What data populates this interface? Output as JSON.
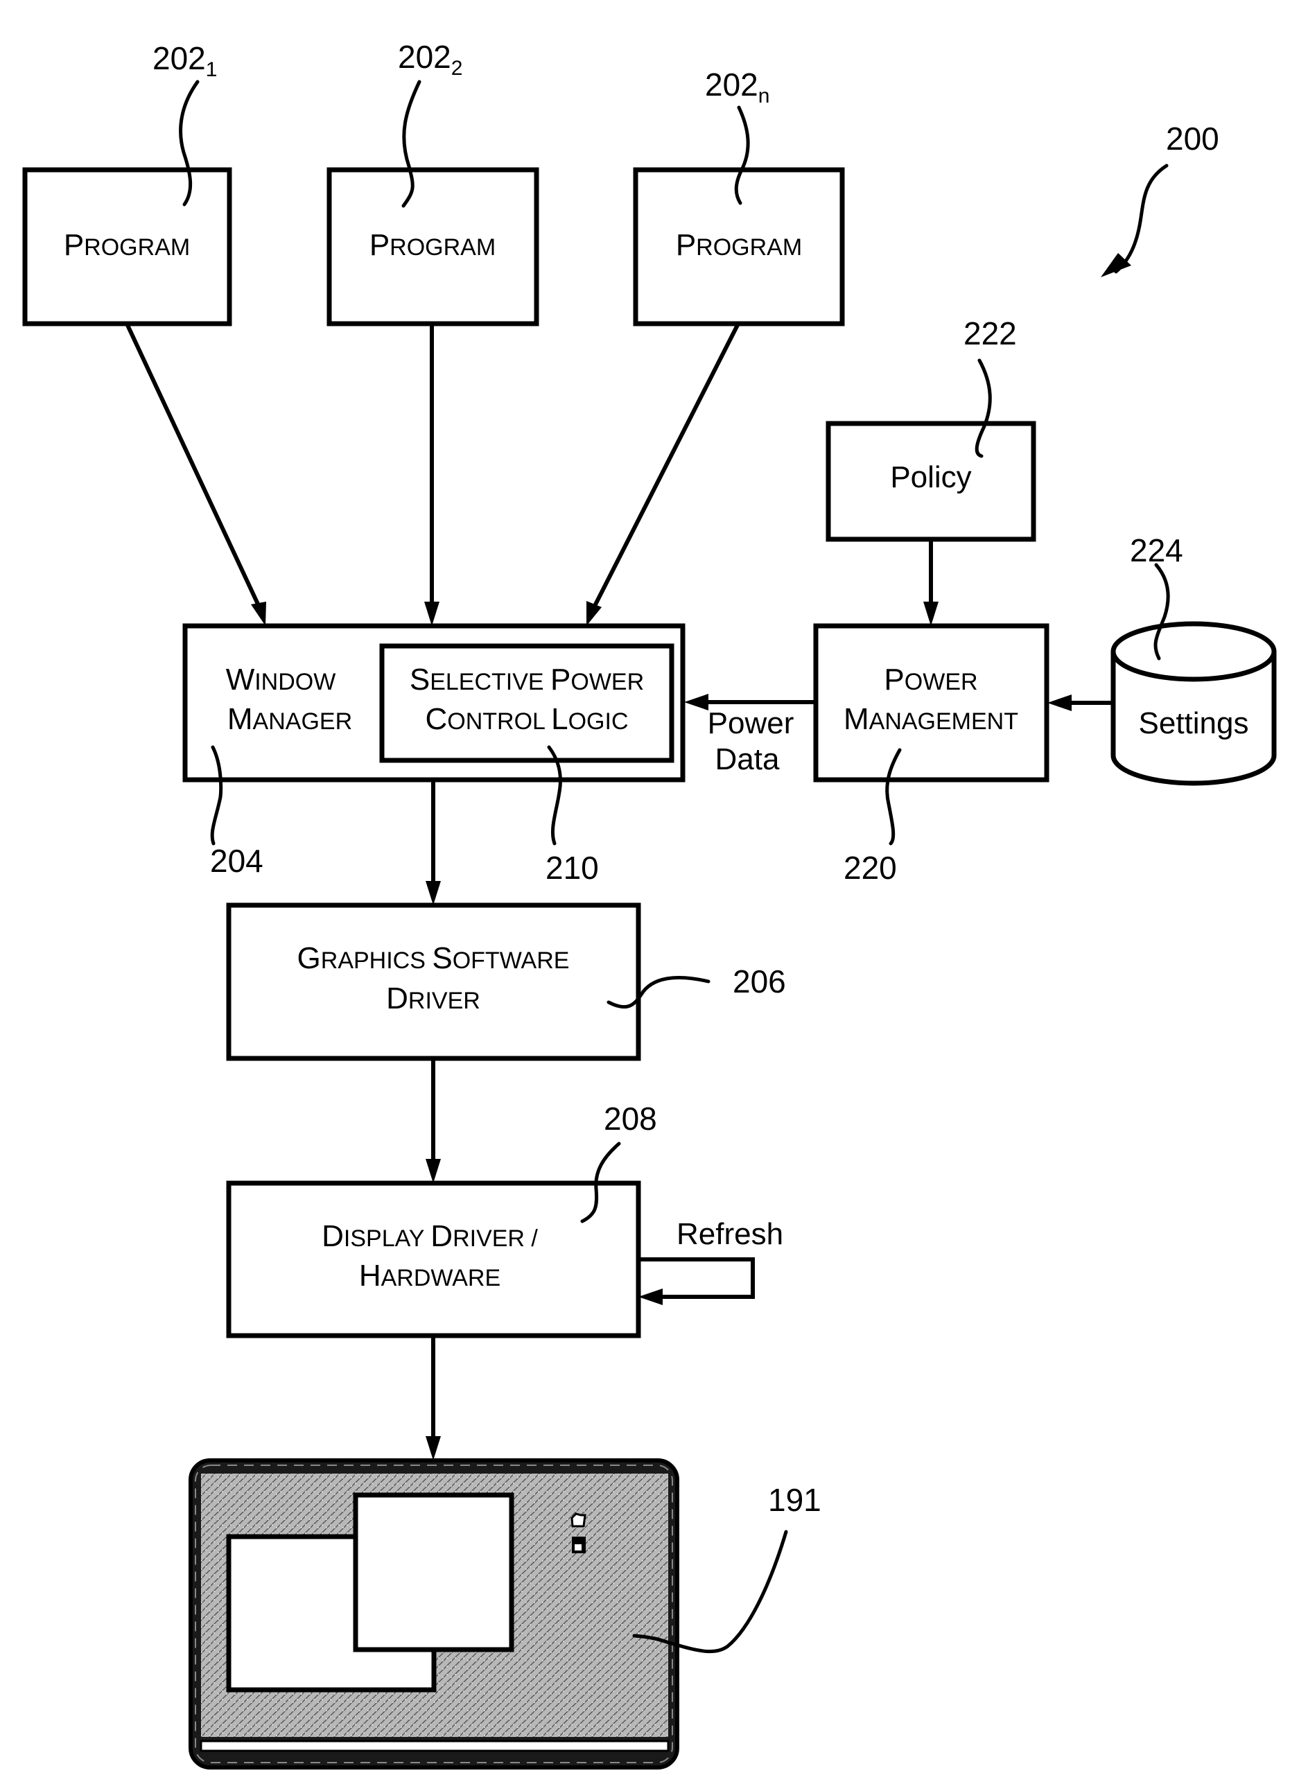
{
  "figure": {
    "ref": "200",
    "colors": {
      "ink": "#000000",
      "paper": "#ffffff",
      "screen_texture": "#9a9a9a"
    }
  },
  "programs": [
    {
      "label_first": "P",
      "label_rest": "ROGRAM",
      "ref": "202",
      "ref_sub": "1"
    },
    {
      "label_first": "P",
      "label_rest": "ROGRAM",
      "ref": "202",
      "ref_sub": "2"
    },
    {
      "label_first": "P",
      "label_rest": "ROGRAM",
      "ref": "202",
      "ref_sub": "n"
    }
  ],
  "window_manager": {
    "line1_first": "W",
    "line1_rest": "INDOW",
    "line2_first": "M",
    "line2_rest": "ANAGER",
    "ref": "204"
  },
  "selective_power": {
    "line1": [
      {
        "first": "S",
        "rest": "ELECTIVE"
      },
      {
        "first": "P",
        "rest": "OWER"
      }
    ],
    "line2": [
      {
        "first": "C",
        "rest": "ONTROL"
      },
      {
        "first": "L",
        "rest": "OGIC"
      }
    ],
    "ref": "210"
  },
  "policy": {
    "label": "Policy",
    "ref": "222"
  },
  "power_management": {
    "line1_first": "P",
    "line1_rest": "OWER",
    "line2_first": "M",
    "line2_rest": "ANAGEMENT",
    "ref": "220"
  },
  "settings": {
    "label": "Settings",
    "ref": "224"
  },
  "power_data": {
    "line1": "Power",
    "line2": "Data"
  },
  "graphics_driver": {
    "line1": [
      {
        "first": "G",
        "rest": "RAPHICS"
      },
      {
        "first": "S",
        "rest": "OFTWARE"
      }
    ],
    "line2": [
      {
        "first": "D",
        "rest": "RIVER"
      }
    ],
    "ref": "206"
  },
  "display_driver": {
    "line1": [
      {
        "first": "D",
        "rest": "ISPLAY"
      },
      {
        "first": "D",
        "rest": "RIVER /"
      }
    ],
    "line2": [
      {
        "first": "H",
        "rest": "ARDWARE"
      }
    ],
    "ref": "208"
  },
  "refresh": {
    "label": "Refresh"
  },
  "display": {
    "ref": "191",
    "windows": [
      "window-back",
      "window-front"
    ],
    "desktop_icons": [
      "folder-icon",
      "document-icon"
    ]
  }
}
